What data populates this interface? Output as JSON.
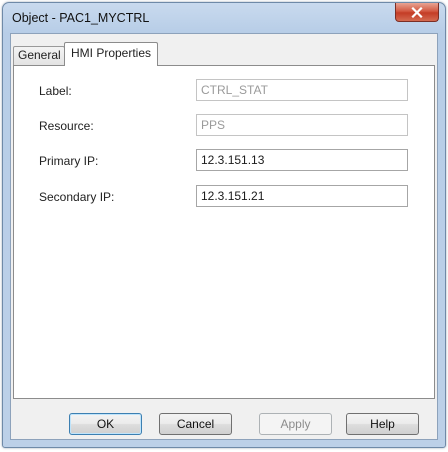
{
  "window": {
    "title": "Object - PAC1_MYCTRL",
    "close_icon": "close-x"
  },
  "tabs": [
    {
      "label": "General",
      "selected": false
    },
    {
      "label": "HMI Properties",
      "selected": true
    }
  ],
  "form": {
    "label": {
      "caption": "Label:",
      "value": "CTRL_STAT",
      "readonly": true
    },
    "resource": {
      "caption": "Resource:",
      "value": "PPS",
      "readonly": true
    },
    "primary_ip": {
      "caption": "Primary IP:",
      "value": "12.3.151.13",
      "readonly": false
    },
    "secondary_ip": {
      "caption": "Secondary IP:",
      "value": "12.3.151.21",
      "readonly": false
    }
  },
  "buttons": {
    "ok": "OK",
    "cancel": "Cancel",
    "apply": "Apply",
    "help": "Help"
  },
  "colors": {
    "titlebar": "#bcd0e8",
    "close_button": "#c43c26",
    "default_button_border": "#3c7fb1"
  }
}
